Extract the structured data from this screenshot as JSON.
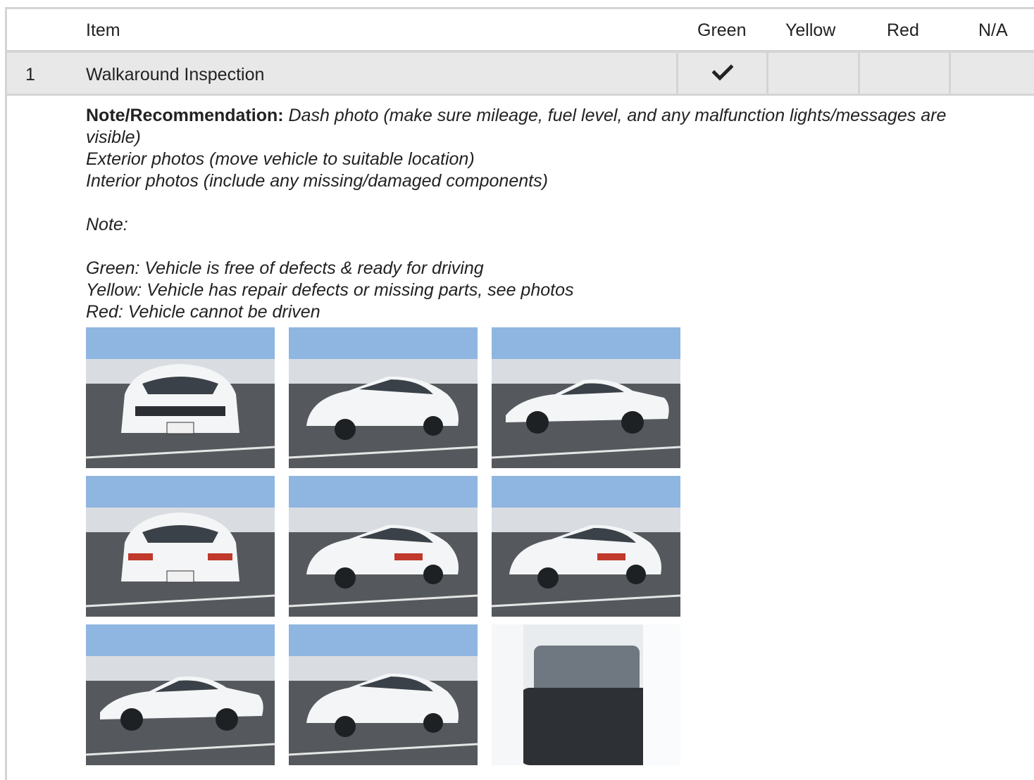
{
  "table": {
    "headers": {
      "item": "Item",
      "green": "Green",
      "yellow": "Yellow",
      "red": "Red",
      "na": "N/A"
    },
    "rows": [
      {
        "number": "1",
        "item": "Walkaround Inspection",
        "selected": "green",
        "check_icon": "checkmark-icon"
      }
    ]
  },
  "note": {
    "label": "Note/Recommendation:",
    "line1": "Dash photo (make sure mileage, fuel level, and any malfunction lights/messages are visible)",
    "line2": "Exterior photos (move vehicle to suitable location)",
    "line3": "Interior photos (include any missing/damaged components)",
    "line4": "Note:",
    "line5": "Green: Vehicle is free of defects & ready for driving",
    "line6": "Yellow: Vehicle has repair defects or missing parts, see photos",
    "line7": "Red: Vehicle cannot be driven"
  },
  "photos": {
    "count": 9,
    "icon": "car-photo-icon",
    "car_color": "#f4f5f6",
    "sky_color": "#8fb6e0",
    "ground_color": "#55595e"
  }
}
